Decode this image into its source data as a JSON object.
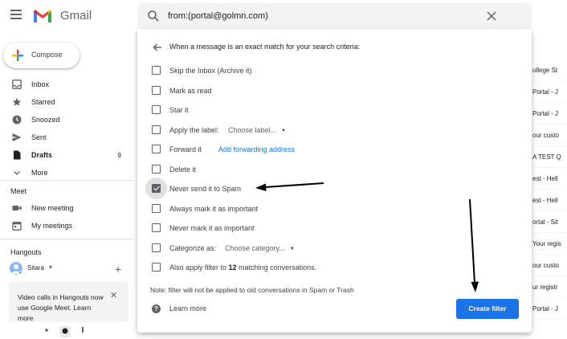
{
  "app": {
    "name": "Gmail"
  },
  "search": {
    "query": "from:(portal@golmn.com)"
  },
  "sidebar": {
    "compose_label": "Compose",
    "items": [
      {
        "label": "Inbox",
        "icon": "inbox-icon",
        "count": ""
      },
      {
        "label": "Starred",
        "icon": "star-icon",
        "count": ""
      },
      {
        "label": "Snoozed",
        "icon": "clock-icon",
        "count": ""
      },
      {
        "label": "Sent",
        "icon": "send-icon",
        "count": ""
      },
      {
        "label": "Drafts",
        "icon": "draft-icon",
        "count": "9"
      },
      {
        "label": "More",
        "icon": "chevron-down-icon",
        "count": ""
      }
    ],
    "meet": {
      "title": "Meet",
      "items": [
        {
          "label": "New meeting",
          "icon": "video-icon"
        },
        {
          "label": "My meetings",
          "icon": "calendar-icon"
        }
      ]
    },
    "hangouts": {
      "title": "Hangouts",
      "user": "Sitara",
      "promo": "Video calls in Hangouts now use Google Meet. Learn more"
    }
  },
  "filter": {
    "heading": "When a message is an exact match for your search criteria:",
    "options": [
      {
        "label": "Skip the Inbox (Archive it)",
        "checked": false
      },
      {
        "label": "Mark as read",
        "checked": false
      },
      {
        "label": "Star it",
        "checked": false
      },
      {
        "label": "Apply the label:",
        "checked": false,
        "select": "Choose label..."
      },
      {
        "label": "Forward it",
        "checked": false,
        "link": "Add forwarding address"
      },
      {
        "label": "Delete it",
        "checked": false
      },
      {
        "label": "Never send it to Spam",
        "checked": true
      },
      {
        "label": "Always mark it as important",
        "checked": false
      },
      {
        "label": "Never mark it as important",
        "checked": false
      },
      {
        "label": "Categorize as:",
        "checked": false,
        "select": "Choose category..."
      },
      {
        "label_pre": "Also apply filter to ",
        "label_count": "12",
        "label_post": " matching conversations.",
        "checked": false
      }
    ],
    "note": "Note: filter will not be applied to old conversations in Spam or Trash",
    "learn_more": "Learn more",
    "create_button": "Create filter"
  },
  "email_list_edge": [
    "ollege St",
    "Portal - J",
    "Portal - J",
    "our custo",
    "A TEST Q",
    "est - Hell",
    "est - Hell",
    "ortal - Sit",
    "Your regis",
    "our custo",
    "ur registr",
    "Portal - J"
  ],
  "colors": {
    "accent": "#1a73e8",
    "arrow": "#000000"
  }
}
